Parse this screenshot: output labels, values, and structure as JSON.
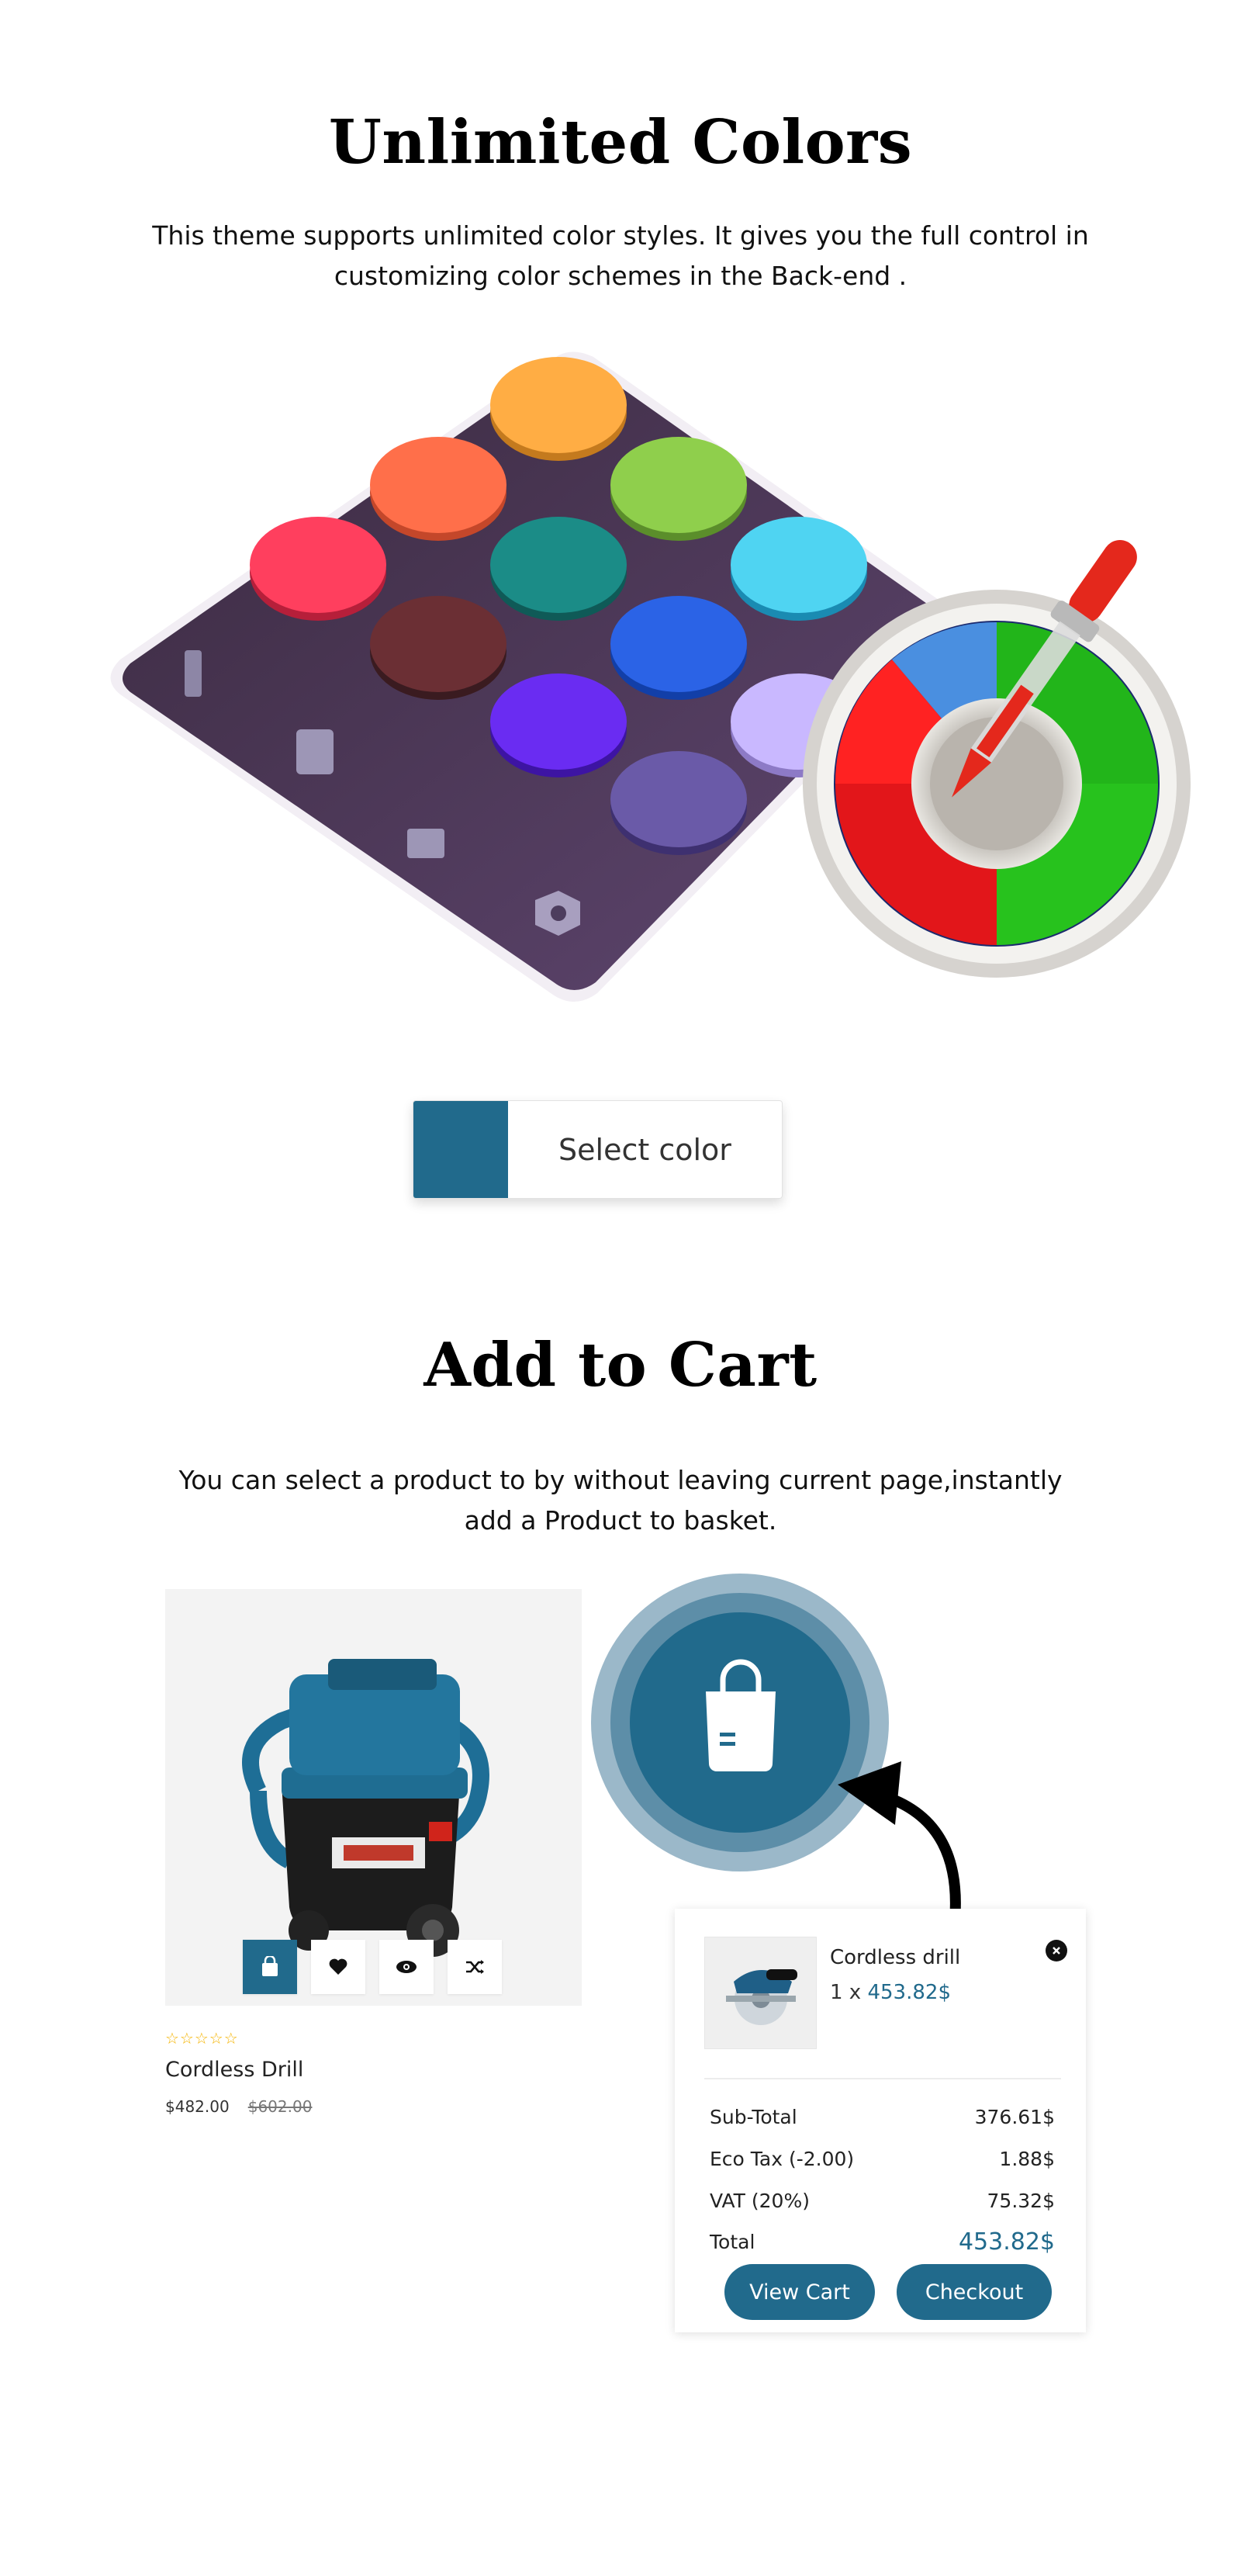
{
  "colors_section": {
    "title": "Unlimited Colors",
    "description": "This theme supports unlimited color styles. It gives you the full control in customizing color schemes in the Back-end .",
    "select_color_label": "Select color",
    "accent_color": "#216a8c"
  },
  "cart_section": {
    "title": "Add to Cart",
    "description": "You can select a product to by without leaving current page,instantly add a Product to basket.",
    "product": {
      "name": "Cordless Drill",
      "rating": "☆☆☆☆☆",
      "price": "$482.00",
      "old_price": "$602.00",
      "actions": [
        "cart-icon",
        "heart-icon",
        "eye-icon",
        "shuffle-icon"
      ]
    },
    "mini_cart": {
      "item_name": "Cordless drill",
      "item_qty": "1 x",
      "item_price": "453.82$",
      "rows": [
        {
          "label": "Sub-Total",
          "value": "376.61$"
        },
        {
          "label": "Eco Tax (-2.00)",
          "value": "1.88$"
        },
        {
          "label": "VAT (20%)",
          "value": "75.32$"
        },
        {
          "label": "Total",
          "value": "453.82$"
        }
      ],
      "view_cart_label": "View Cart",
      "checkout_label": "Checkout"
    }
  }
}
